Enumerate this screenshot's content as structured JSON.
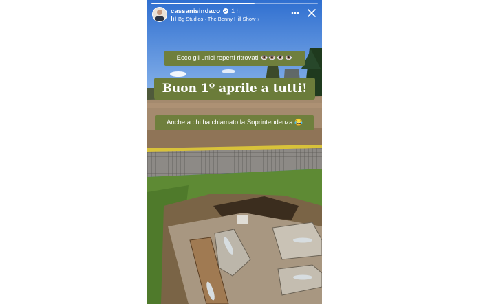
{
  "story": {
    "username": "cassanisindaco",
    "time_ago": "1 h",
    "music": "Bg Studios · The Benny Hill Show",
    "progress": 0.62,
    "icons": {
      "verified": "verified-icon",
      "music": "music-note-icon",
      "more": "more-options-icon",
      "close": "close-icon"
    }
  },
  "captions": {
    "line1": "Ecco gli unici reperti ritrovati 👁️👁️👁️👁️",
    "line2": "Buon 1º aprile a tutti!",
    "line3": "Anche a chi ha chiamato la Soprintendenza 😂"
  },
  "colors": {
    "sticker": "#6f7f3d",
    "sky": "#3f7fd8",
    "grass": "#5e8a34"
  }
}
